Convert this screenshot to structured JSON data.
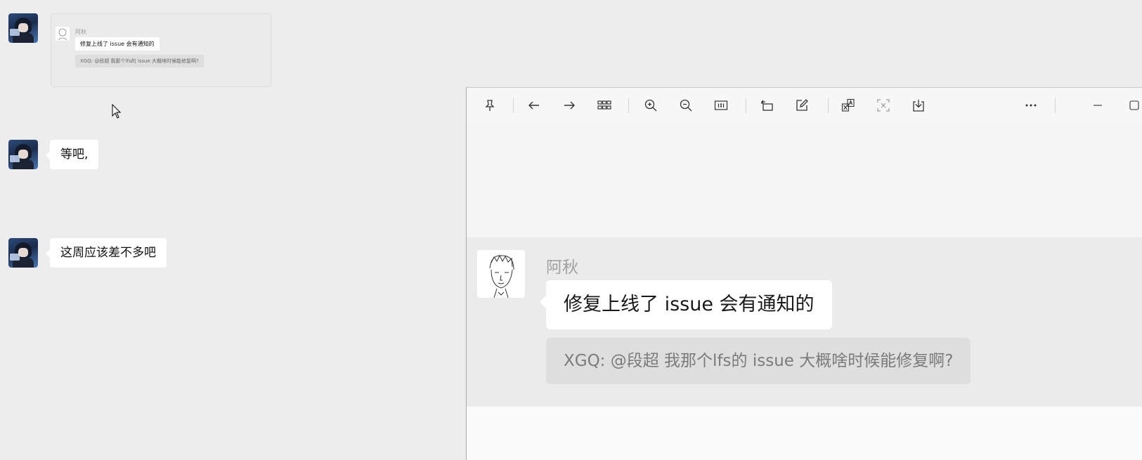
{
  "chat": {
    "thumbnail": {
      "name": "阿秋",
      "message": "修复上线了 issue 会有通知的",
      "quote": "XGQ: @段超  我那个lfs的 issue 大概啥时候能修复啊?"
    },
    "messages": [
      {
        "text": "等吧,"
      },
      {
        "text": "这周应该差不多吧"
      }
    ]
  },
  "viewer": {
    "toolbar": {
      "pin": "pin-icon",
      "back": "arrow-left-icon",
      "forward": "arrow-right-icon",
      "grid": "grid-icon",
      "zoom_in": "zoom-in-icon",
      "zoom_out": "zoom-out-icon",
      "actual_size": "actual-size-icon",
      "rotate": "rotate-icon",
      "edit": "edit-icon",
      "translate": "translate-icon",
      "extract_text": "extract-text-icon",
      "download": "download-icon",
      "more": "more-icon",
      "minimize": "minimize-icon",
      "maximize": "maximize-icon"
    },
    "image": {
      "name": "阿秋",
      "message": "修复上线了 issue 会有通知的",
      "quote": "XGQ: @段超  我那个lfs的 issue 大概啥时候能修复啊?"
    }
  }
}
